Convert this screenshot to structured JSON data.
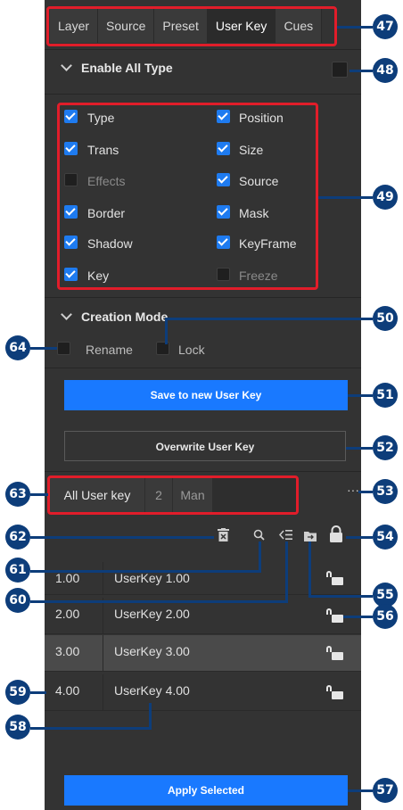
{
  "tabs": [
    "Layer",
    "Source",
    "Preset",
    "User Key",
    "Cues"
  ],
  "enable_all_type": {
    "label": "Enable All Type"
  },
  "types": {
    "left": [
      {
        "label": "Type",
        "checked": true
      },
      {
        "label": "Trans",
        "checked": true
      },
      {
        "label": "Effects",
        "checked": false
      },
      {
        "label": "Border",
        "checked": true
      },
      {
        "label": "Shadow",
        "checked": true
      },
      {
        "label": "Key",
        "checked": true
      }
    ],
    "right": [
      {
        "label": "Position",
        "checked": true
      },
      {
        "label": "Size",
        "checked": true
      },
      {
        "label": "Source",
        "checked": true
      },
      {
        "label": "Mask",
        "checked": true
      },
      {
        "label": "KeyFrame",
        "checked": true
      },
      {
        "label": "Freeze",
        "checked": false
      }
    ]
  },
  "creation_mode": {
    "label": "Creation Mode",
    "rename": "Rename",
    "lock": "Lock"
  },
  "buttons": {
    "save": "Save to new User Key",
    "overwrite": "Overwrite User Key",
    "apply": "Apply Selected"
  },
  "filter": {
    "tabs": [
      "All User key",
      "2",
      "Man"
    ],
    "more": "···"
  },
  "rows": [
    {
      "num": "1.00",
      "name": "UserKey 1.00"
    },
    {
      "num": "2.00",
      "name": "UserKey 2.00"
    },
    {
      "num": "3.00",
      "name": "UserKey 3.00"
    },
    {
      "num": "4.00",
      "name": "UserKey 4.00"
    }
  ],
  "callouts": [
    "47",
    "48",
    "49",
    "50",
    "51",
    "52",
    "53",
    "54",
    "55",
    "56",
    "57",
    "58",
    "59",
    "60",
    "61",
    "62",
    "63",
    "64"
  ],
  "colors": {
    "accent": "#1979ff",
    "callout": "#0d3d7a",
    "highlight": "#e11d2a",
    "panel": "#333333"
  }
}
